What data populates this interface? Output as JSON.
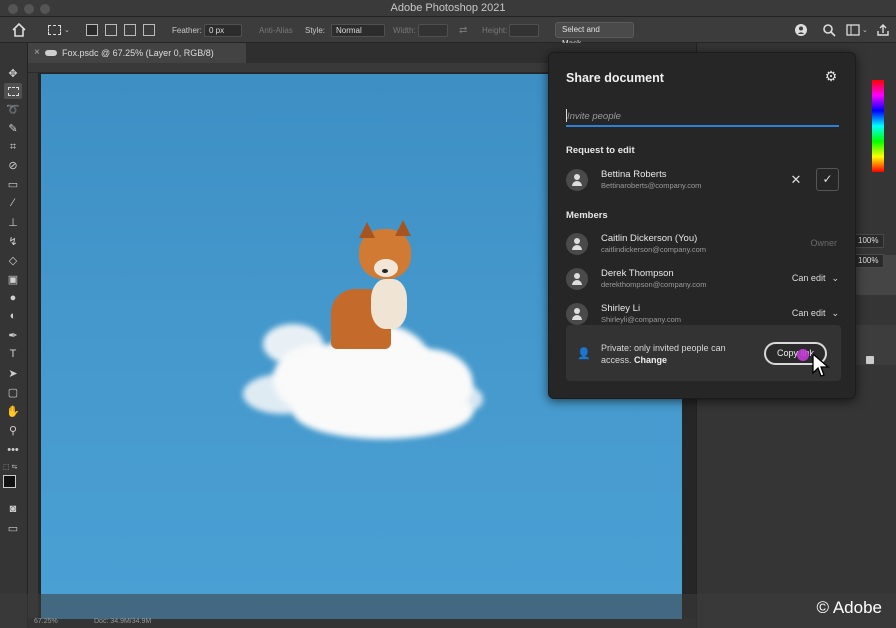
{
  "app": {
    "title": "Adobe Photoshop 2021"
  },
  "options_bar": {
    "feather_label": "Feather:",
    "feather_value": "0 px",
    "anti_alias_label": "Anti-Alias",
    "style_label": "Style:",
    "style_value": "Normal",
    "width_label": "Width:",
    "height_label": "Height:",
    "select_mask_label": "Select and Mask..."
  },
  "document_tab": {
    "label": "Fox.psdc @ 67.25% (Layer 0, RGB/8)",
    "close": "×"
  },
  "share_panel": {
    "title": "Share document",
    "invite_placeholder": "Invite people",
    "request_heading": "Request to edit",
    "requests": [
      {
        "name": "Bettina Roberts",
        "email": "Bettinaroberts@company.com"
      }
    ],
    "members_heading": "Members",
    "members": [
      {
        "name": "Caitlin Dickerson (You)",
        "email": "caitlindickerson@company.com",
        "role": "Owner"
      },
      {
        "name": "Derek Thompson",
        "email": "derekthompson@company.com",
        "role": "Can edit"
      },
      {
        "name": "Shirley Li",
        "email": "Shirleyli@company.com",
        "role": "Can edit"
      }
    ],
    "privacy_text": "Private: only invited people can access.",
    "privacy_change": "Change",
    "copy_link_label": "Copy link"
  },
  "right_panel": {
    "opacity_value": "100%",
    "fill_value": "100%"
  },
  "status_bar": {
    "zoom": "67.25%",
    "doc": "Doc: 34.9M/34.9M"
  },
  "watermark": "© Adobe",
  "colors": {
    "accent": "#2f7fd6",
    "click_indicator": "#c23bd6",
    "panel_bg": "#262626"
  }
}
